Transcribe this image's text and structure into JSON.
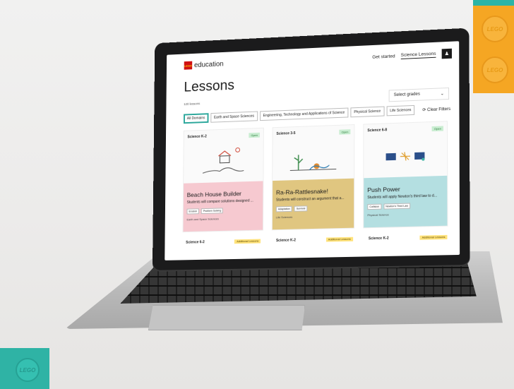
{
  "brand": {
    "logo_mark": "LEGO",
    "name": "education",
    "brick_colors": {
      "orange": "#f5a623",
      "teal": "#2fb3a5"
    },
    "stud_text": "LEGO"
  },
  "nav": {
    "get_started": "Get started",
    "science_lessons": "Science Lessons",
    "user_icon": "user-icon"
  },
  "page": {
    "title": "Lessons",
    "count": "120 lessons",
    "grade_select": "Select grades"
  },
  "filters": {
    "chips": [
      "All Domains",
      "Earth and Space Sciences",
      "Engineering, Technology and Applications of Science",
      "Physical Science",
      "Life Sciences"
    ],
    "clear": "Clear Filters"
  },
  "cards": [
    {
      "course": "Science K-2",
      "status": "Open",
      "title": "Beach House Builder",
      "desc": "Students will compare solutions designed ...",
      "tags": [
        "Erosion",
        "Problem Solving"
      ],
      "domain": "Earth and Space Sciences",
      "color": "#f6c9d0"
    },
    {
      "course": "Science 3-5",
      "status": "Open",
      "title": "Ra-Ra-Rattlesnake!",
      "desc": "Students will construct an argument that a...",
      "tags": [
        "Adaptation",
        "Survival"
      ],
      "domain": "Life Sciences",
      "color": "#e0c680"
    },
    {
      "course": "Science 6-8",
      "status": "Open",
      "title": "Push Power",
      "desc": "Students will apply Newton's third law to d...",
      "tags": [
        "Collision",
        "Newton's Third Law"
      ],
      "domain": "Physical Science",
      "color": "#b4dfe1"
    }
  ],
  "next_row": [
    {
      "course": "Science 6-2",
      "badge": "Additional Lessons"
    },
    {
      "course": "Science K-2",
      "badge": "Additional Lessons"
    },
    {
      "course": "Science K-2",
      "badge": "Additional Lessons"
    }
  ]
}
